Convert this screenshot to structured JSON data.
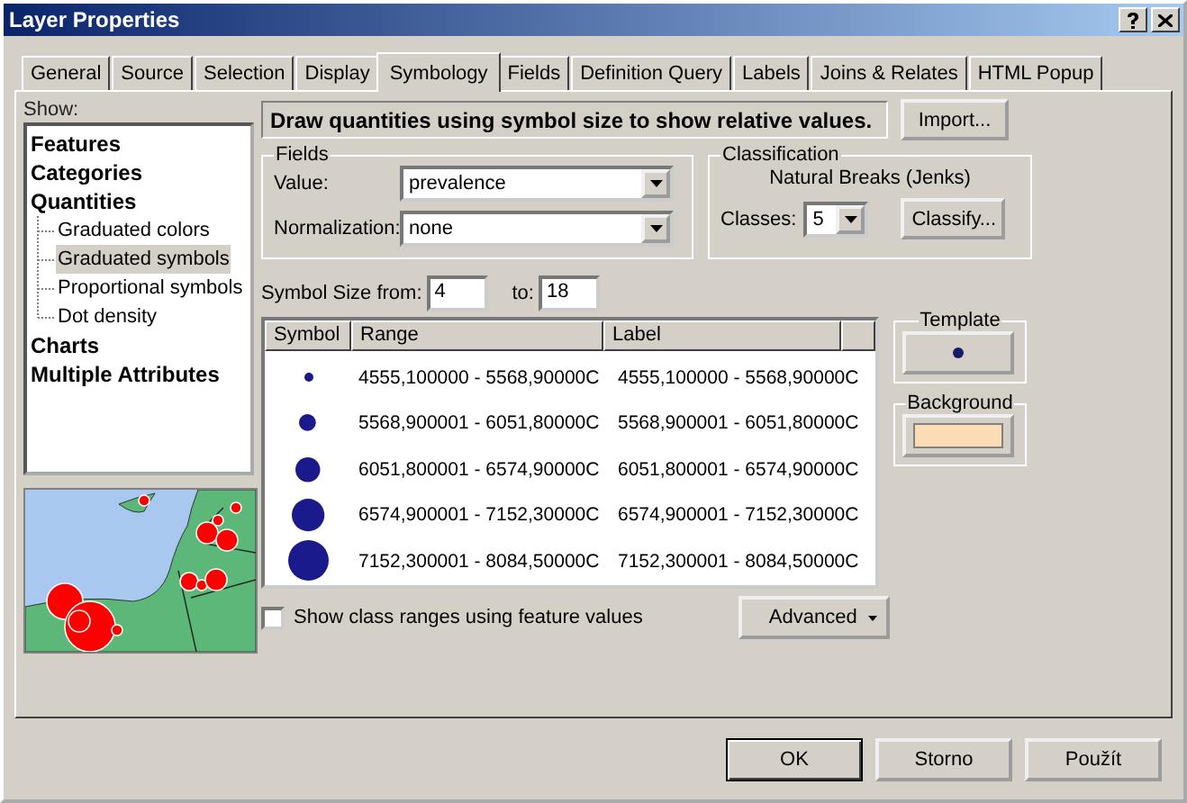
{
  "window": {
    "title": "Layer Properties"
  },
  "tabs": [
    {
      "label": "General",
      "selected": false
    },
    {
      "label": "Source",
      "selected": false
    },
    {
      "label": "Selection",
      "selected": false
    },
    {
      "label": "Display",
      "selected": false
    },
    {
      "label": "Symbology",
      "selected": true
    },
    {
      "label": "Fields",
      "selected": false
    },
    {
      "label": "Definition Query",
      "selected": false
    },
    {
      "label": "Labels",
      "selected": false
    },
    {
      "label": "Joins & Relates",
      "selected": false
    },
    {
      "label": "HTML Popup",
      "selected": false
    }
  ],
  "show": {
    "label": "Show:",
    "items": [
      {
        "label": "Features",
        "selected": false
      },
      {
        "label": "Categories",
        "selected": false
      },
      {
        "label": "Quantities",
        "selected": false,
        "children": [
          {
            "label": "Graduated colors",
            "selected": false
          },
          {
            "label": "Graduated symbols",
            "selected": true
          },
          {
            "label": "Proportional symbols",
            "selected": false
          },
          {
            "label": "Dot density",
            "selected": false
          }
        ]
      },
      {
        "label": "Charts",
        "selected": false
      },
      {
        "label": "Multiple Attributes",
        "selected": false
      }
    ]
  },
  "description": "Draw quantities using symbol size to show relative values.",
  "import_button": "Import...",
  "fields": {
    "title": "Fields",
    "value_label": "Value:",
    "value": "prevalence",
    "normalization_label": "Normalization:",
    "normalization": "none"
  },
  "classification": {
    "title": "Classification",
    "method": "Natural Breaks (Jenks)",
    "classes_label": "Classes:",
    "classes": "5",
    "classify_button": "Classify..."
  },
  "symbol_size": {
    "from_label": "Symbol Size from:",
    "from": "4",
    "to_label": "to:",
    "to": "18"
  },
  "table": {
    "columns": [
      "Symbol",
      "Range",
      "Label"
    ],
    "rows": [
      {
        "range": "4555,100000 - 5568,90000C",
        "label": "4555,100000 - 5568,90000C"
      },
      {
        "range": "5568,900001 - 6051,80000C",
        "label": "5568,900001 - 6051,80000C"
      },
      {
        "range": "6051,800001 - 6574,90000C",
        "label": "6051,800001 - 6574,90000C"
      },
      {
        "range": "6574,900001 - 7152,30000C",
        "label": "6574,900001 - 7152,30000C"
      },
      {
        "range": "7152,300001 - 8084,50000C",
        "label": "7152,300001 - 8084,50000C"
      }
    ]
  },
  "template": {
    "title": "Template"
  },
  "background": {
    "title": "Background",
    "color": "#fcdcb4"
  },
  "show_class_ranges": {
    "label": "Show class ranges using feature values",
    "checked": false
  },
  "advanced_button": "Advanced",
  "buttons": [
    {
      "label": "OK",
      "default": true
    },
    {
      "label": "Storno",
      "default": false
    },
    {
      "label": "Použít",
      "default": false
    }
  ]
}
